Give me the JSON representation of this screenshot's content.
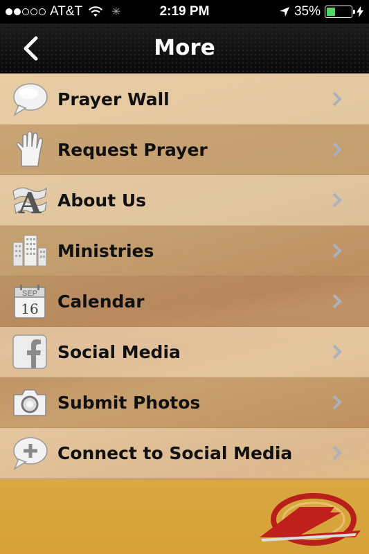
{
  "status_bar": {
    "carrier": "AT&T",
    "time": "2:19 PM",
    "battery_percent": "35%",
    "battery_level": 0.35,
    "signal_bars": 2
  },
  "nav": {
    "title": "More",
    "back_icon": "chevron-left-icon"
  },
  "menu": {
    "items": [
      {
        "label": "Prayer Wall",
        "icon": "speech-bubble-icon"
      },
      {
        "label": "Request Prayer",
        "icon": "hand-icon"
      },
      {
        "label": "About Us",
        "icon": "letter-a-icon"
      },
      {
        "label": "Ministries",
        "icon": "buildings-icon"
      },
      {
        "label": "Calendar",
        "icon": "calendar-icon",
        "calendar_month": "SEP",
        "calendar_day": "16"
      },
      {
        "label": "Social Media",
        "icon": "facebook-icon"
      },
      {
        "label": "Submit Photos",
        "icon": "camera-icon"
      },
      {
        "label": "Connect to Social Media",
        "icon": "speech-bubble-plus-icon"
      }
    ]
  },
  "colors": {
    "nav_bg": "#111111",
    "footer_bg": "#d8a640",
    "chevron": "#aab3bd",
    "logo_red": "#c0201c"
  }
}
